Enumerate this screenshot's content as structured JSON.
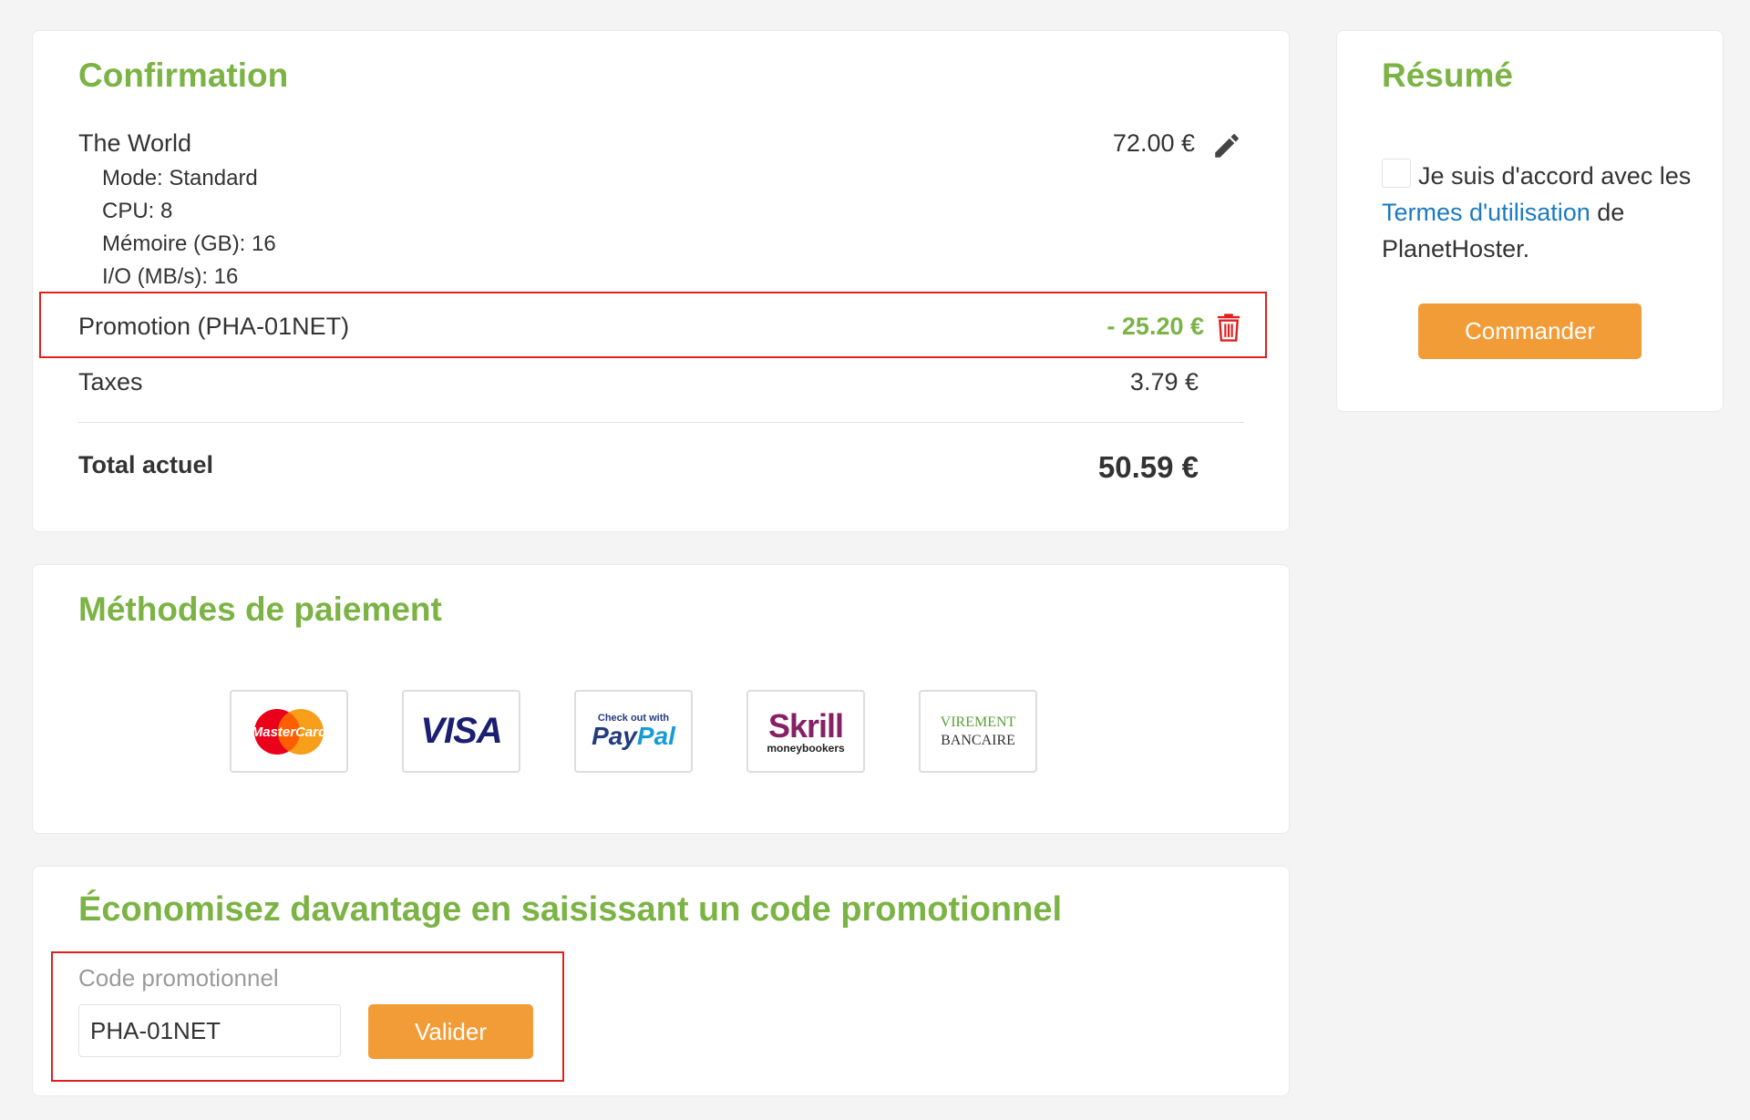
{
  "confirmation": {
    "title": "Confirmation",
    "product": {
      "name": "The World",
      "price": "72.00 €",
      "details": [
        "Mode: Standard",
        "CPU: 8",
        "Mémoire (GB): 16",
        "I/O (MB/s): 16"
      ]
    },
    "promotion": {
      "label": "Promotion (PHA-01NET)",
      "amount": "- 25.20 €"
    },
    "taxes": {
      "label": "Taxes",
      "amount": "3.79 €"
    },
    "total": {
      "label": "Total actuel",
      "amount": "50.59 €"
    }
  },
  "payment": {
    "title": "Méthodes de paiement",
    "methods": {
      "mastercard": "MasterCard",
      "visa": "VISA",
      "paypal_small": "Check out with",
      "paypal_pay": "Pay",
      "paypal_pal": "Pal",
      "skrill": "Skrill",
      "skrill_sub": "moneybookers",
      "virement_top": "VIREMENT",
      "virement_bottom": "BANCAIRE"
    }
  },
  "promo": {
    "title": "Économisez davantage en saisissant un code promotionnel",
    "label": "Code promotionnel",
    "value": "PHA-01NET",
    "button": "Valider"
  },
  "summary": {
    "title": "Résumé",
    "agree_prefix": "Je suis d'accord avec les",
    "terms_link": "Termes d'utilisation",
    "agree_suffix": "de PlanetHoster.",
    "button": "Commander"
  },
  "colors": {
    "accent_green": "#7bb344",
    "button_orange": "#f29c38",
    "link_blue": "#1b7ac0",
    "highlight_red": "#e02020"
  }
}
